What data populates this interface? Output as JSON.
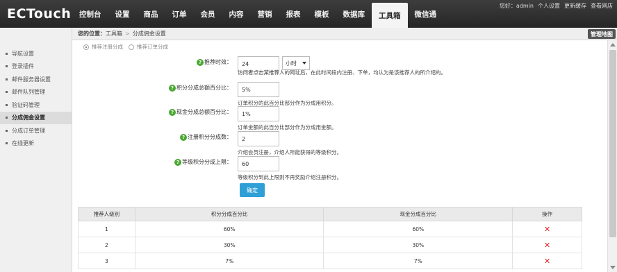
{
  "app": {
    "logo": "ECTouch"
  },
  "nav": {
    "items": [
      {
        "label": "控制台"
      },
      {
        "label": "设置"
      },
      {
        "label": "商品"
      },
      {
        "label": "订单"
      },
      {
        "label": "会员"
      },
      {
        "label": "内容"
      },
      {
        "label": "营销"
      },
      {
        "label": "报表"
      },
      {
        "label": "模板"
      },
      {
        "label": "数据库"
      },
      {
        "label": "工具箱",
        "active": true
      },
      {
        "label": "微信通"
      }
    ]
  },
  "top_links": {
    "greeting": "您好：admin",
    "profile": "个人设置",
    "clear_cache": "更新缓存",
    "view_shop": "查看网店"
  },
  "breadcrumb": {
    "prefix": "您的位置：",
    "level1": "工具箱",
    "separator": ">",
    "level2": "分成佣金设置",
    "sitemap_button": "管理地图"
  },
  "sidebar": {
    "items": [
      {
        "label": "导航设置"
      },
      {
        "label": "登录插件"
      },
      {
        "label": "邮件服务器设置"
      },
      {
        "label": "邮件队列管理"
      },
      {
        "label": "验证码管理"
      },
      {
        "label": "分成佣金设置",
        "active": true
      },
      {
        "label": "分成订单管理"
      },
      {
        "label": "在线更新"
      }
    ]
  },
  "radios": {
    "option1": "推荐注册分成",
    "option2": "推荐订单分成",
    "selected": "option1"
  },
  "form": {
    "fields": [
      {
        "label": "推荐时效：",
        "value": "24",
        "unit_select": "小时",
        "hint": "访问者点击某推荐人的网址后，在此时间段内注册、下单，均认为是该推荐人的所介绍的。"
      },
      {
        "label": "积分分成总额百分比：",
        "value": "5%",
        "hint": "订单积分的此百分比部分作为分成用积分。"
      },
      {
        "label": "现金分成总额百分比：",
        "value": "1%",
        "hint": "订单金额的此百分比部分作为分成用金额。"
      },
      {
        "label": "注册积分分成数：",
        "value": "2",
        "hint": "介绍会员注册，介绍人所能获得的等级积分。"
      },
      {
        "label": "等级积分分成上限：",
        "value": "60",
        "hint": "等级积分到此上限则不再奖励介绍注册积分。"
      }
    ],
    "submit_label": "确定"
  },
  "table": {
    "headers": [
      "推荐人级别",
      "积分分成百分比",
      "现金分成百分比",
      "操作"
    ],
    "rows": [
      {
        "level": "1",
        "points_pct": "60%",
        "cash_pct": "60%"
      },
      {
        "level": "2",
        "points_pct": "30%",
        "cash_pct": "30%"
      },
      {
        "level": "3",
        "points_pct": "7%",
        "cash_pct": "7%"
      }
    ],
    "delete_glyph": "✕"
  },
  "colors": {
    "topbar": "#2e2e2e",
    "accent_button": "#2f9fd8",
    "help_icon": "#4aa832",
    "delete": "#d81e1e"
  }
}
